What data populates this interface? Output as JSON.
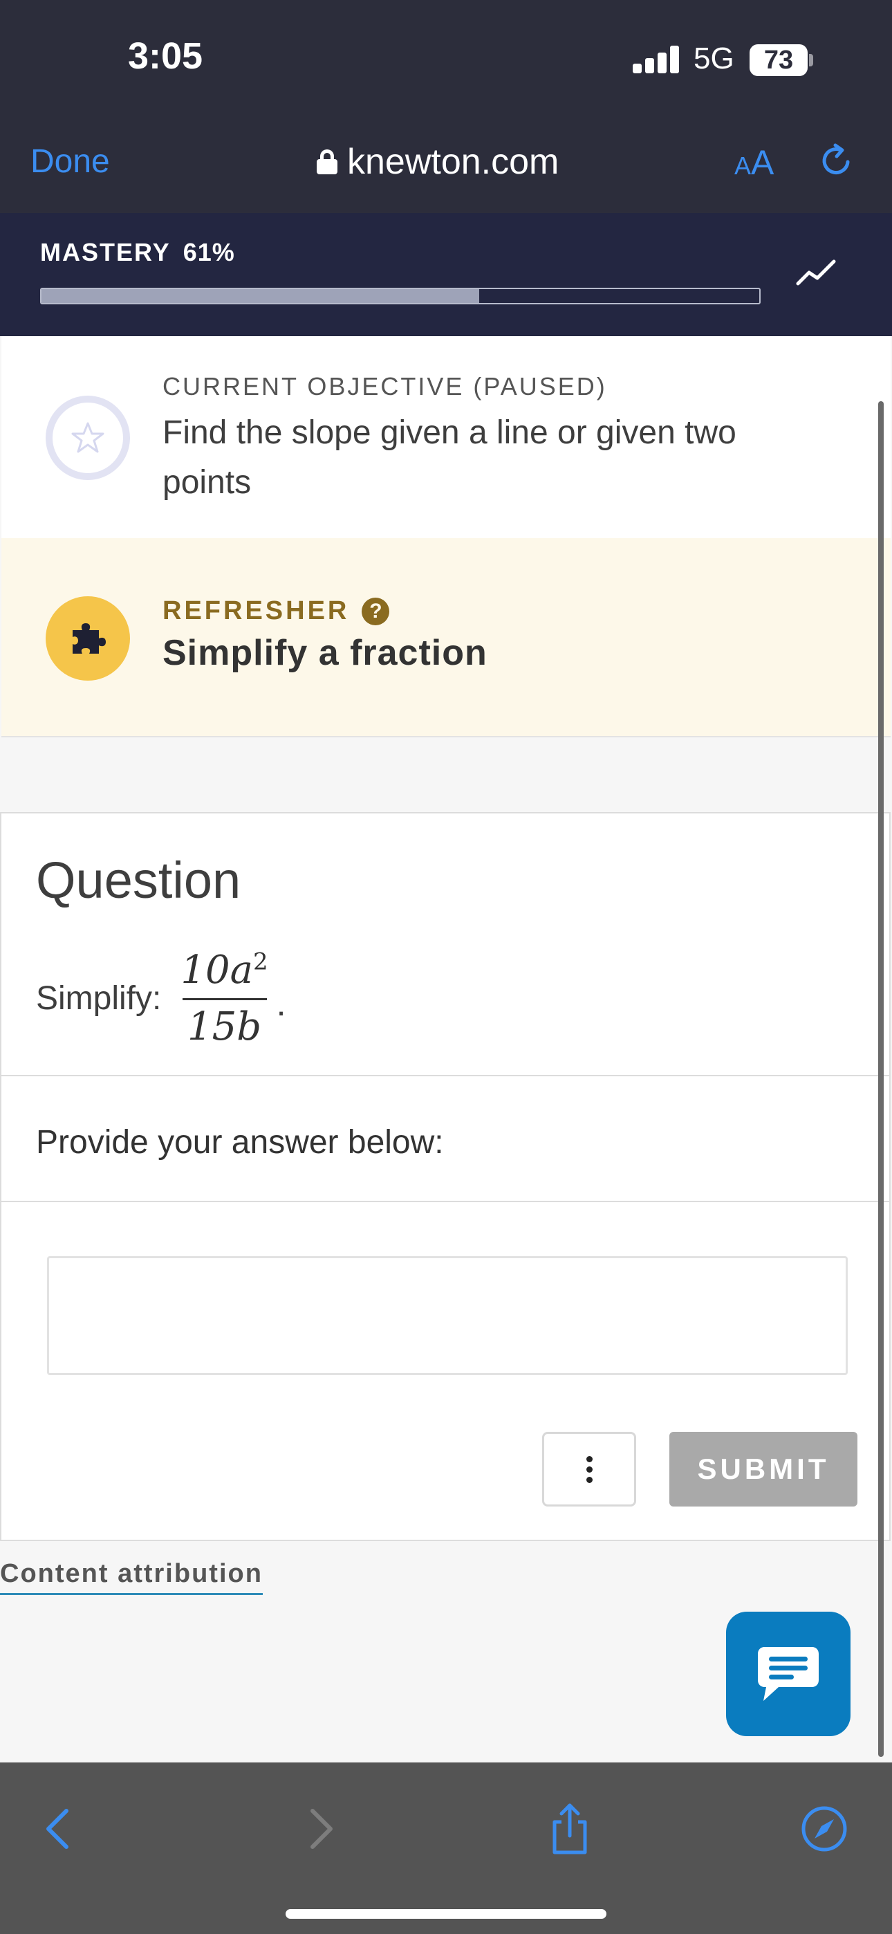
{
  "status_bar": {
    "time": "3:05",
    "network": "5G",
    "battery": "73"
  },
  "browser": {
    "done_label": "Done",
    "url": "knewton.com",
    "text_size_small": "A",
    "text_size_large": "A"
  },
  "mastery": {
    "label": "MASTERY",
    "percent_text": "61%",
    "progress_fraction": 0.61
  },
  "objective": {
    "caption": "CURRENT OBJECTIVE (PAUSED)",
    "text": "Find the slope given a line or given two points"
  },
  "refresher": {
    "caption": "REFRESHER",
    "help_glyph": "?",
    "text": "Simplify a fraction"
  },
  "question": {
    "title": "Question",
    "prompt_label": "Simplify:",
    "numerator": "10a",
    "numerator_exponent": "2",
    "denominator": "15b",
    "period": ".",
    "provide_label": "Provide your answer below:",
    "answer_value": "",
    "submit_label": "SUBMIT"
  },
  "footer": {
    "attribution_label": "Content attribution"
  },
  "colors": {
    "chrome_bg": "#2c2d3b",
    "mastery_bg": "#232641",
    "accent_link": "#3b8df0",
    "refresher_bg": "#fdf8e9",
    "refresher_accent": "#8a6b20",
    "puzzle_circle": "#f5c54a",
    "chat_button": "#0a7cbf",
    "submit_disabled": "#a9a9a9",
    "toolbar_bg": "#545454"
  },
  "icons": {
    "lock": "lock-icon",
    "reload": "reload-icon",
    "trend": "trend-chart-icon",
    "star": "star-icon",
    "puzzle": "puzzle-icon",
    "help": "help-icon",
    "more": "more-vertical-icon",
    "chat": "chat-icon",
    "back": "back-chevron-icon",
    "forward": "forward-chevron-icon",
    "share": "share-icon",
    "compass": "compass-icon"
  }
}
